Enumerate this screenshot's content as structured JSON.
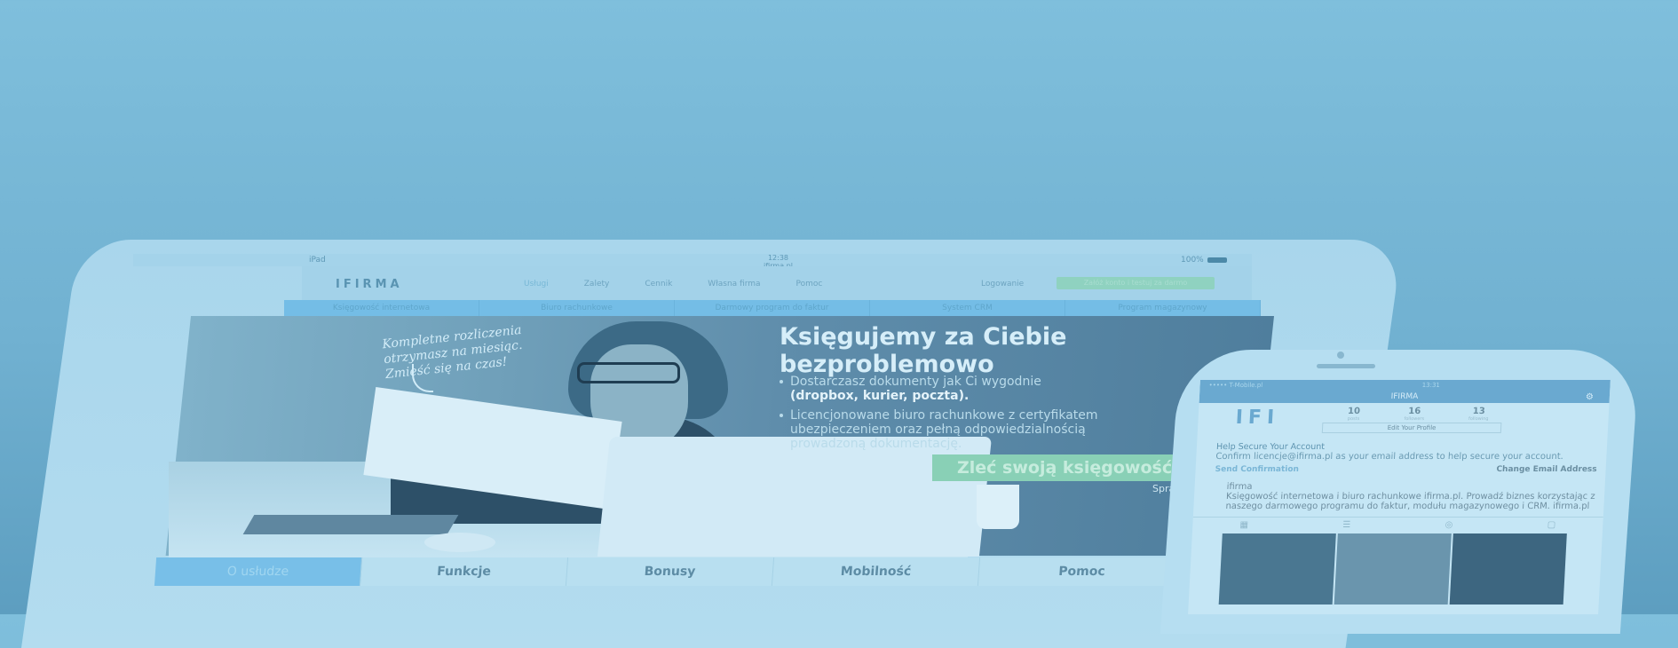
{
  "ipad": {
    "status": {
      "left": "iPad",
      "time": "12:38",
      "site": "ifirma.pl",
      "battery": "100%"
    },
    "logo": "IFIRMA",
    "nav": [
      "Usługi",
      "Zalety",
      "Cennik",
      "Własna firma",
      "Pomoc"
    ],
    "login": "Logowanie",
    "cta_top": "Załóż konto i testuj za darmo",
    "subnav": [
      "Księgowość internetowa",
      "Biuro rachunkowe",
      "Darmowy program do faktur",
      "System CRM",
      "Program magazynowy"
    ],
    "handwriting": [
      "Kompletne rozliczenia",
      "otrzymasz na miesiąc.",
      "Zmieść się na czas!"
    ],
    "hero_title_1": "Księgujemy za Ciebie",
    "hero_title_2": "bezproblemowo",
    "bullet_1a": "Dostarczasz dokumenty jak Ci wygodnie",
    "bullet_1b": "(dropbox, kurier, poczta).",
    "bullet_2a": "Licencjonowane biuro rachunkowe z certyfikatem",
    "bullet_2b": "ubezpieczeniem oraz pełną odpowiedzialnością",
    "bullet_2c": "prowadzoną dokumentację.",
    "hero_cta": "Zleć swoją księgowość",
    "hero_link": "Sprawdź",
    "tabs": [
      "O usłudze",
      "Funkcje",
      "Bonusy",
      "Mobilność",
      "Pomoc"
    ]
  },
  "iphone": {
    "status_left": "••••• T-Mobile.pl",
    "status_time": "13:31",
    "navbar_title": "IFIRMA",
    "logo": "IFI",
    "stats": [
      {
        "value": "10",
        "label": "posts"
      },
      {
        "value": "16",
        "label": "followers"
      },
      {
        "value": "13",
        "label": "following"
      }
    ],
    "edit_profile": "Edit Your Profile",
    "alert_title": "Help Secure Your Account",
    "alert_text": "Confirm licencje@ifirma.pl as your email address to help secure your account.",
    "send_confirmation": "Send Confirmation",
    "change_email": "Change Email Address",
    "bio_name": "ifirma",
    "bio_text": "Księgowość internetowa i biuro rachunkowe ifirma.pl. Prowadź biznes korzystając z naszego darmowego programu do faktur, modułu magazynowego i CRM. ifirma.pl"
  }
}
